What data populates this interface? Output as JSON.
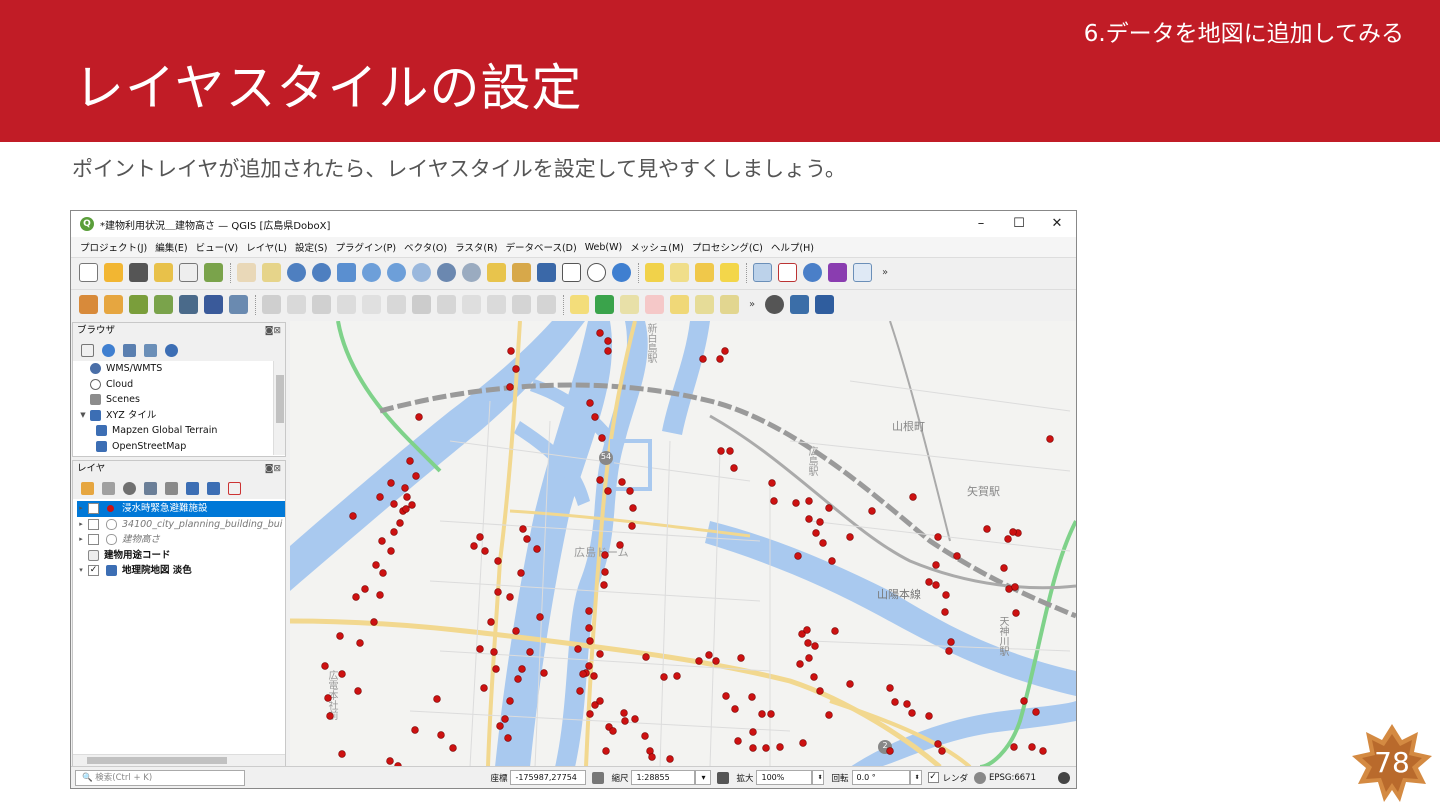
{
  "slide": {
    "section": "6.データを地図に追加してみる",
    "title": "レイヤスタイルの設定",
    "subtitle": "ポイントレイヤが追加されたら、レイヤスタイルを設定して見やすくしましょう。",
    "page_number": "78",
    "accent_color": "#c11c26"
  },
  "window": {
    "title": "*建物利用状況＿建物高さ — QGIS [広島県DoboX]",
    "controls": [
      "–",
      "☐",
      "✕"
    ]
  },
  "menu": [
    "プロジェクト(J)",
    "編集(E)",
    "ビュー(V)",
    "レイヤ(L)",
    "設定(S)",
    "プラグイン(P)",
    "ベクタ(O)",
    "ラスタ(R)",
    "データベース(D)",
    "Web(W)",
    "メッシュ(M)",
    "プロセシング(C)",
    "ヘルプ(H)"
  ],
  "browser_panel": {
    "title": "ブラウザ",
    "items": [
      {
        "label": "WMS/WMTS",
        "icon": "globe-icon"
      },
      {
        "label": "Cloud",
        "icon": "cloud-icon"
      },
      {
        "label": "Scenes",
        "icon": "cube-icon"
      },
      {
        "label": "XYZ タイル",
        "icon": "grid-icon"
      },
      {
        "label": "Mapzen Global Terrain",
        "icon": "tile-icon"
      },
      {
        "label": "OpenStreetMap",
        "icon": "tile-icon"
      }
    ]
  },
  "layers_panel": {
    "title": "レイヤ",
    "layers": [
      {
        "label": "浸水時緊急避難施設",
        "checked": true,
        "selected": true
      },
      {
        "label": "34100_city_planning_building_bui",
        "checked": false,
        "selected": false
      },
      {
        "label": "建物高さ",
        "checked": false,
        "selected": false
      },
      {
        "label": "建物用途コード",
        "checked": null,
        "selected": false
      },
      {
        "label": "地理院地図 淡色",
        "checked": true,
        "selected": false
      }
    ]
  },
  "map": {
    "labels": [
      "新白島駅",
      "山根町",
      "矢賀駅",
      "広島駅",
      "広島ドーム",
      "山陽本線",
      "天神川駅",
      "広電本社前",
      "54",
      "2"
    ],
    "point_color": "#cc1111"
  },
  "status_bar": {
    "search_placeholder": "検索(Ctrl + K)",
    "coord_label": "座標",
    "coord_value": "-175987,27754",
    "scale_label": "縮尺",
    "scale_value": "1:28855",
    "magnifier_label": "拡大",
    "magnifier_value": "100%",
    "rotation_label": "回転",
    "rotation_value": "0.0 °",
    "render_label": "レンダ",
    "crs": "EPSG:6671"
  }
}
